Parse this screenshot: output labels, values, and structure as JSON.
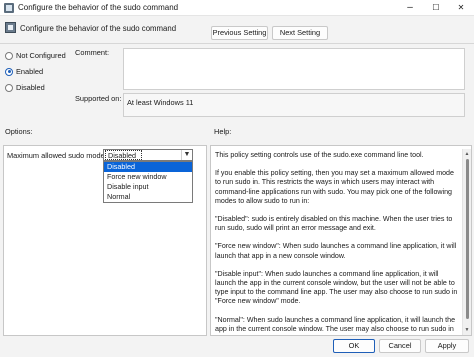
{
  "window": {
    "title": "Configure the behavior of the sudo command",
    "minimize": "–",
    "maximize": "☐",
    "close": "✕"
  },
  "header": {
    "setting_name": "Configure the behavior of the sudo command",
    "prev_button": "Previous Setting",
    "next_button": "Next Setting"
  },
  "state": {
    "options": [
      {
        "label": "Not Configured",
        "selected": false
      },
      {
        "label": "Enabled",
        "selected": true
      },
      {
        "label": "Disabled",
        "selected": false
      }
    ]
  },
  "comment": {
    "label": "Comment:",
    "value": ""
  },
  "supported": {
    "label": "Supported on:",
    "value": "At least Windows 11"
  },
  "options_panel": {
    "label": "Options:",
    "field_label": "Maximum allowed sudo mode",
    "selected_value": "Disabled",
    "dropdown_items": [
      "Disabled",
      "Force new window",
      "Disable input",
      "Normal"
    ]
  },
  "help": {
    "label": "Help:",
    "paragraphs": [
      "This policy setting controls use of the sudo.exe command line tool.",
      "If you enable this policy setting, then you may set a maximum allowed mode to run sudo in. This restricts the ways in which users may interact with command-line applications run with sudo. You may pick one of the following modes to allow sudo to run in:",
      "\"Disabled\": sudo is entirely disabled on this machine. When the user tries to run sudo, sudo will print an error message and exit.",
      "\"Force new window\": When sudo launches a command line application, it will launch that app in a new console window.",
      "\"Disable input\": When sudo launches a command line application, it will launch the app in the current console window, but the user will not be able to type input to the command line app. The user may also choose to run sudo in \"Force new window\" mode.",
      "\"Normal\": When sudo launches a command line application, it will launch the app in the current console window. The user may also choose to run sudo in \"Force new"
    ]
  },
  "footer": {
    "ok": "OK",
    "cancel": "Cancel",
    "apply": "Apply"
  }
}
